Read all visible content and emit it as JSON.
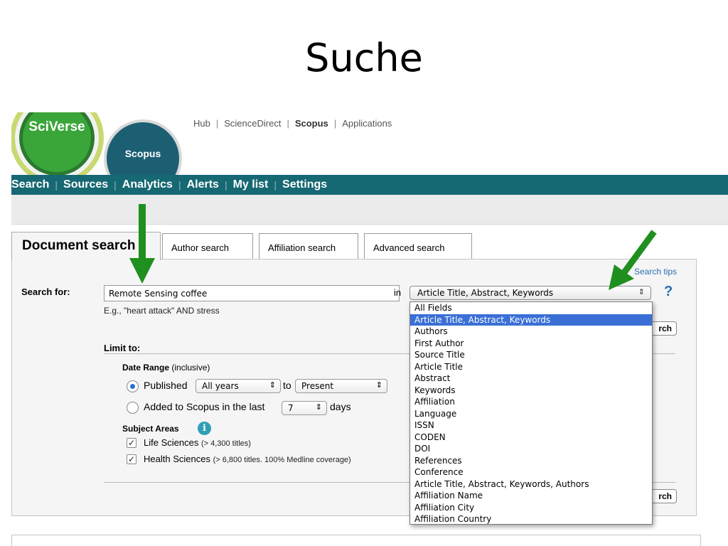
{
  "slide": {
    "title": "Suche"
  },
  "logos": {
    "sciverse": "SciVerse",
    "scopus": "Scopus"
  },
  "top_links": [
    {
      "label": "Hub",
      "active": false
    },
    {
      "label": "ScienceDirect",
      "active": false
    },
    {
      "label": "Scopus",
      "active": true
    },
    {
      "label": "Applications",
      "active": false
    }
  ],
  "nav": [
    "Search",
    "Sources",
    "Analytics",
    "Alerts",
    "My list",
    "Settings"
  ],
  "tabs": {
    "document": "Document search",
    "author": "Author search",
    "affiliation": "Affiliation search",
    "advanced": "Advanced search"
  },
  "search": {
    "tips": "Search tips",
    "label": "Search for:",
    "value": "Remote Sensing coffee",
    "in_label": "in",
    "field_selected": "Article Title, Abstract, Keywords",
    "help": "?",
    "example": "E.g., \"heart attack\" AND stress",
    "button_partial": "rch"
  },
  "limit": {
    "label": "Limit to:",
    "date_range_bold": "Date Range",
    "date_range_note": "(inclusive)",
    "published_label": "Published",
    "years_from": "All years",
    "to_label": "to",
    "years_to": "Present",
    "added_label": "Added to Scopus in the last",
    "days_value": "7",
    "days_label": "days"
  },
  "subjects": {
    "label": "Subject Areas",
    "info": "i",
    "items": [
      {
        "name": "Life Sciences",
        "note": "(> 4,300 titles)",
        "checked": true
      },
      {
        "name": "Health Sciences",
        "note": "(> 6,800 titles. 100% Medline coverage)",
        "checked": true
      }
    ]
  },
  "dropdown_options": [
    "All Fields",
    "Article Title, Abstract, Keywords",
    "Authors",
    "First Author",
    "Source Title",
    "Article Title",
    "Abstract",
    "Keywords",
    "Affiliation",
    "Language",
    "ISSN",
    "CODEN",
    "DOI",
    "References",
    "Conference",
    "Article Title, Abstract, Keywords, Authors",
    "Affiliation Name",
    "Affiliation City",
    "Affiliation Country"
  ],
  "dropdown_selected_index": 1,
  "colors": {
    "nav_bar": "#166873",
    "annotation_arrow": "#1f8f1f",
    "selection": "#3a6fd6"
  }
}
